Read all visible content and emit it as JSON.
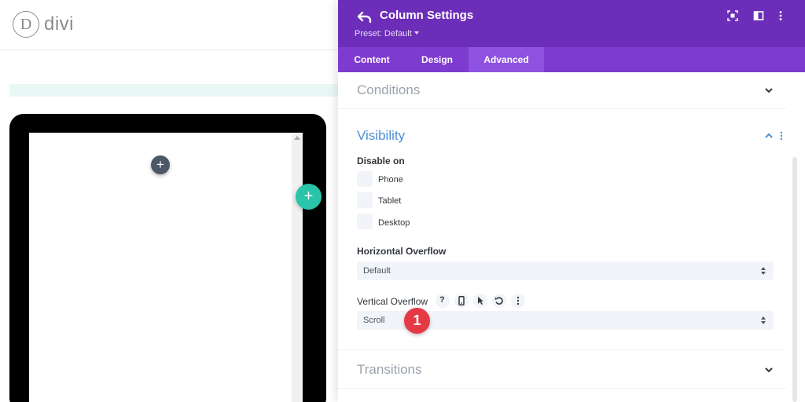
{
  "brand": {
    "logo_letter": "D",
    "logo_text": "divi"
  },
  "builder": {
    "add_module_glyph": "+",
    "add_row_glyph": "+"
  },
  "panel": {
    "title": "Column Settings",
    "preset": "Preset: Default",
    "header_icons": [
      "expand-icon",
      "split-view-icon",
      "more-vertical-icon"
    ],
    "tabs": [
      {
        "label": "Content",
        "active": false
      },
      {
        "label": "Design",
        "active": false
      },
      {
        "label": "Advanced",
        "active": true
      }
    ]
  },
  "sections": {
    "conditions": {
      "title": "Conditions",
      "expanded": false
    },
    "visibility": {
      "title": "Visibility",
      "expanded": true,
      "disable_on_label": "Disable on",
      "options": [
        {
          "label": "Phone",
          "checked": false
        },
        {
          "label": "Tablet",
          "checked": false
        },
        {
          "label": "Desktop",
          "checked": false
        }
      ],
      "horizontal_overflow": {
        "label": "Horizontal Overflow",
        "value": "Default"
      },
      "vertical_overflow": {
        "label": "Vertical Overflow",
        "value": "Scroll",
        "help_glyph": "?",
        "tool_icons": [
          "help-icon",
          "phone-icon",
          "cursor-icon",
          "reset-icon",
          "more-vertical-icon"
        ]
      }
    },
    "transitions": {
      "title": "Transitions",
      "expanded": false
    }
  },
  "step_badge": "1",
  "colors": {
    "header": "#6c2eb9",
    "tabs": "#7e3bd0",
    "tab_active": "#8f52e0",
    "accent_blue": "#4c8ed6",
    "muted_title": "#9aa3ad",
    "builder_green": "#29c4a9",
    "badge_red": "#e63946"
  }
}
